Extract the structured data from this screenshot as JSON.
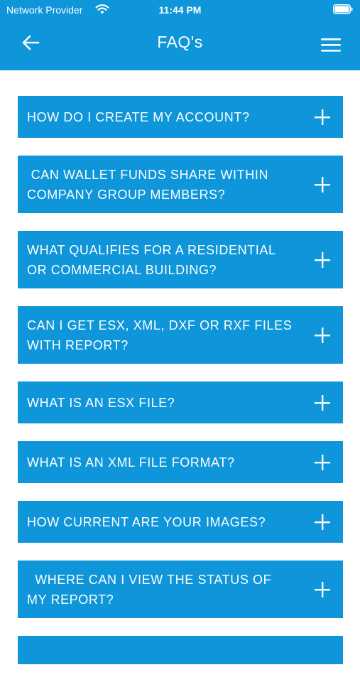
{
  "status_bar": {
    "carrier": "Network Provider",
    "time": "11:44 PM"
  },
  "header": {
    "title": "FAQ's",
    "back_icon": "arrow-left-icon",
    "menu_icon": "hamburger-menu-icon"
  },
  "colors": {
    "accent": "#0E95DA",
    "text_on_accent": "#FFFFFF",
    "background": "#FFFFFF"
  },
  "faqs": [
    {
      "question": "HOW DO I CREATE MY ACCOUNT?"
    },
    {
      "question": " CAN WALLET FUNDS SHARE WITHIN COMPANY GROUP MEMBERS?"
    },
    {
      "question": "WHAT QUALIFIES FOR A RESIDENTIAL OR COMMERCIAL BUILDING?"
    },
    {
      "question": "CAN I GET ESX, XML, DXF OR RXF FILES WITH REPORT?"
    },
    {
      "question": "WHAT IS AN ESX FILE?"
    },
    {
      "question": "WHAT IS AN XML FILE FORMAT?"
    },
    {
      "question": "HOW CURRENT ARE YOUR IMAGES?"
    },
    {
      "question": "  WHERE CAN I VIEW THE STATUS OF MY REPORT?"
    }
  ],
  "expand_icon": "plus-icon"
}
